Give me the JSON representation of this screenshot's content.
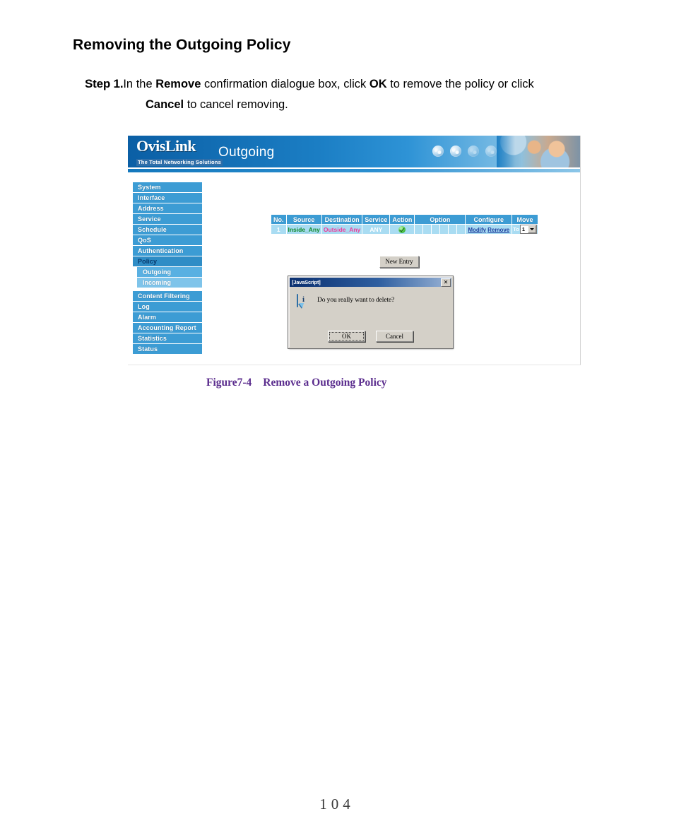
{
  "document": {
    "heading": "Removing the Outgoing Policy",
    "step": {
      "label": "Step 1.",
      "line1_a": "In the ",
      "line1_remove": "Remove",
      "line1_b": " confirmation dialogue box, click ",
      "line1_ok": "OK",
      "line1_c": " to remove the policy or click",
      "line2_cancel": "Cancel",
      "line2_b": " to cancel removing."
    },
    "figure_caption": {
      "number": "Figure7-4",
      "text": "Remove a Outgoing Policy"
    },
    "page_number": "104"
  },
  "screenshot": {
    "banner": {
      "logo_main": "OvisLink",
      "logo_sub": "The Total Networking Solutions",
      "title": "Outgoing",
      "icons": [
        "globe-icon",
        "globe-icon",
        "globe-icon",
        "globe-icon"
      ]
    },
    "sidebar": {
      "items": [
        {
          "label": "System",
          "type": "item",
          "state": "normal"
        },
        {
          "label": "Interface",
          "type": "item",
          "state": "normal"
        },
        {
          "label": "Address",
          "type": "item",
          "state": "normal"
        },
        {
          "label": "Service",
          "type": "item",
          "state": "normal"
        },
        {
          "label": "Schedule",
          "type": "item",
          "state": "normal"
        },
        {
          "label": "QoS",
          "type": "item",
          "state": "normal"
        },
        {
          "label": "Authentication",
          "type": "item",
          "state": "normal"
        },
        {
          "label": "Policy",
          "type": "item",
          "state": "active"
        },
        {
          "label": "Outgoing",
          "type": "sub",
          "state": "selected"
        },
        {
          "label": "Incoming",
          "type": "sub",
          "state": "normal"
        },
        {
          "label": "Content Filtering",
          "type": "item",
          "state": "normal"
        },
        {
          "label": "Log",
          "type": "item",
          "state": "normal"
        },
        {
          "label": "Alarm",
          "type": "item",
          "state": "normal"
        },
        {
          "label": "Accounting Report",
          "type": "item",
          "state": "normal"
        },
        {
          "label": "Statistics",
          "type": "item",
          "state": "normal"
        },
        {
          "label": "Status",
          "type": "item",
          "state": "normal"
        }
      ]
    },
    "policy_table": {
      "headers": {
        "no": "No.",
        "source": "Source",
        "destination": "Destination",
        "service": "Service",
        "action": "Action",
        "option": "Option",
        "configure": "Configure",
        "move": "Move"
      },
      "row": {
        "no": "1",
        "source": "Inside_Any",
        "destination": "Outside_Any",
        "service": "ANY",
        "action_icon": "green-check-icon",
        "option_cells": 6,
        "modify_label": "Modify",
        "remove_label": "Remove",
        "move_to_label": "To",
        "move_value": "1"
      },
      "colors": {
        "header_bg": "#3c9cd4",
        "row_bg": "#a9dcf2",
        "source_text": "#0f8a2a",
        "destination_text": "#ee3a9a",
        "link_text": "#1f3f9e"
      }
    },
    "new_entry_button": "New Entry",
    "dialog": {
      "title": "[JavaScript]",
      "close_label": "✕",
      "icon": "info-icon",
      "icon_glyph": "i",
      "message": "Do you really want to delete?",
      "ok_label": "OK",
      "cancel_label": "Cancel"
    }
  }
}
